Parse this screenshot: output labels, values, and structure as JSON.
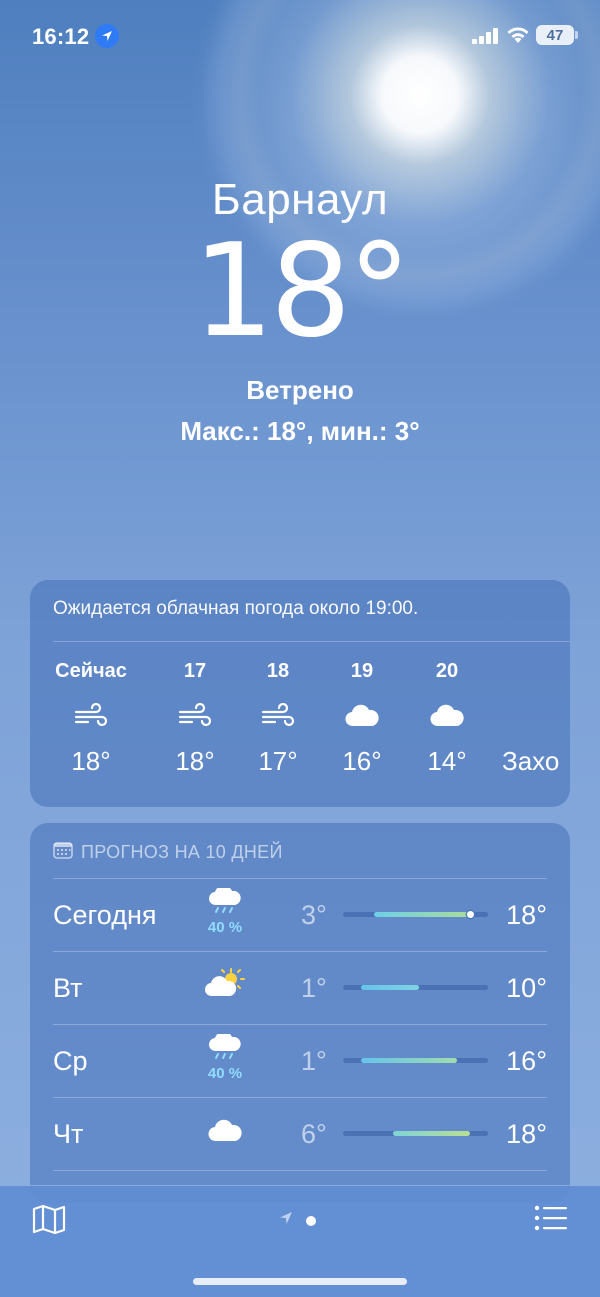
{
  "status_bar": {
    "time": "16:12",
    "battery": "47",
    "icons": [
      "location-arrow-icon",
      "cellular-signal-icon",
      "wifi-icon",
      "battery-icon"
    ]
  },
  "current": {
    "city": "Барнаул",
    "temperature": "18°",
    "condition": "Ветрено",
    "high_low": "Макс.: 18°, мин.: 3°"
  },
  "hourly": {
    "summary": "Ожидается облачная погода около 19:00.",
    "items": [
      {
        "label": "Сейчас",
        "icon": "wind-icon",
        "temp": "18°"
      },
      {
        "label": "17",
        "icon": "wind-icon",
        "temp": "18°"
      },
      {
        "label": "18",
        "icon": "wind-icon",
        "temp": "17°"
      },
      {
        "label": "19",
        "icon": "cloud-icon",
        "temp": "16°"
      },
      {
        "label": "20",
        "icon": "cloud-icon",
        "temp": "14°"
      },
      {
        "label": "",
        "icon": "",
        "temp": "Захо"
      }
    ]
  },
  "daily": {
    "header": "ПРОГНОЗ НА 10 ДНЕЙ",
    "range": {
      "min": 1,
      "max": 18
    },
    "days": [
      {
        "name": "Сегодня",
        "icon": "cloud-rain-icon",
        "precip": "40 %",
        "low": "3°",
        "high": "18°",
        "low_val": 3,
        "high_val": 18,
        "current_val": 18,
        "colors": [
          "#6fcfe8",
          "#a9dc9a"
        ]
      },
      {
        "name": "Вт",
        "icon": "partly-sunny-icon",
        "precip": "",
        "low": "1°",
        "high": "10°",
        "low_val": 1,
        "high_val": 10,
        "colors": [
          "#66c4ea",
          "#7fd3e4"
        ]
      },
      {
        "name": "Ср",
        "icon": "cloud-rain-icon",
        "precip": "40 %",
        "low": "1°",
        "high": "16°",
        "low_val": 1,
        "high_val": 16,
        "colors": [
          "#66c4ea",
          "#9fdcae"
        ]
      },
      {
        "name": "Чт",
        "icon": "cloud-icon",
        "precip": "",
        "low": "6°",
        "high": "18°",
        "low_val": 6,
        "high_val": 18,
        "colors": [
          "#7fd3d8",
          "#b8df92"
        ]
      }
    ]
  },
  "tab_bar": {
    "icons": [
      "map-icon",
      "location-arrow-icon",
      "list-icon"
    ]
  }
}
